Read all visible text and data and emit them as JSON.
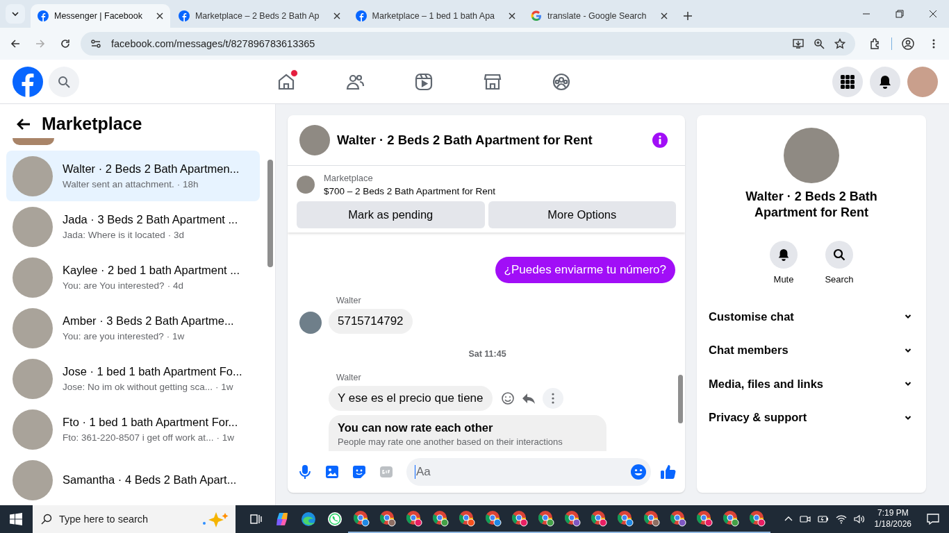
{
  "browser": {
    "tabs": [
      {
        "title": "Messenger | Facebook",
        "selected": true
      },
      {
        "title": "Marketplace – 2 Beds 2 Bath Ap",
        "selected": false
      },
      {
        "title": "Marketplace – 1 bed 1 bath Apa",
        "selected": false
      },
      {
        "title": "translate - Google Search",
        "selected": false
      }
    ],
    "url": "facebook.com/messages/t/827896783613365"
  },
  "nav": [
    {
      "kind": "home",
      "notification": true
    },
    {
      "kind": "friends",
      "notification": false
    },
    {
      "kind": "video",
      "notification": false
    },
    {
      "kind": "marketplace",
      "notification": false
    },
    {
      "kind": "groups",
      "notification": false
    }
  ],
  "sidebar": {
    "title": "Marketplace",
    "items": [
      {
        "name": "Walter · 2 Beds 2 Bath Apartmen...",
        "preview": "Walter sent an attachment.",
        "time": "· 18h",
        "selected": true
      },
      {
        "name": "Jada · 3 Beds 2 Bath Apartment ...",
        "preview": "Jada: Where is it located",
        "time": "· 3d",
        "selected": false
      },
      {
        "name": "Kaylee · 2 bed 1 bath Apartment ...",
        "preview": "You: are You interested?",
        "time": "· 4d",
        "selected": false
      },
      {
        "name": "Amber · 3 Beds 2 Bath Apartme...",
        "preview": "You: are you interested?",
        "time": "· 1w",
        "selected": false
      },
      {
        "name": "Jose · 1 bed 1 bath Apartment Fo...",
        "preview": "Jose: No im ok without getting sca...",
        "time": "· 1w",
        "selected": false
      },
      {
        "name": "Fto · 1 bed 1 bath Apartment For...",
        "preview": "Fto: 361-220-8507 i get off work at...",
        "time": "· 1w",
        "selected": false
      },
      {
        "name": "Samantha · 4 Beds 2 Bath Apart...",
        "selected": false
      }
    ]
  },
  "chat": {
    "title": "Walter · 2 Beds 2 Bath Apartment for Rent",
    "listing": {
      "label": "Marketplace",
      "title": "$700 – 2 Beds 2 Bath Apartment for Rent",
      "buttons": [
        "Mark as pending",
        "More Options"
      ]
    },
    "messages": [
      {
        "kind": "outgoing",
        "text": "¿Puedes enviarme tu número?"
      },
      {
        "kind": "incoming",
        "sender": "Walter",
        "text": "5715714792",
        "avatar": true,
        "actions": false
      },
      {
        "kind": "time",
        "text": "Sat 11:45"
      },
      {
        "kind": "incoming",
        "sender": "Walter",
        "text": "Y ese es el precio que tiene",
        "avatar": false,
        "actions": true
      },
      {
        "kind": "notice",
        "title": "You can now rate each other",
        "text": "People may rate one another based on their interactions"
      }
    ],
    "composer": {
      "placeholder": "Aa"
    }
  },
  "details": {
    "title": "Walter · 2 Beds 2 Bath Apartment for Rent",
    "actions": [
      {
        "kind": "mute",
        "label": "Mute"
      },
      {
        "kind": "search",
        "label": "Search"
      }
    ],
    "sections": [
      "Customise chat",
      "Chat members",
      "Media, files and links",
      "Privacy & support"
    ]
  },
  "taskbar": {
    "search_placeholder": "Type here to search",
    "time": "7:19 PM",
    "date": "1/18/2026"
  }
}
